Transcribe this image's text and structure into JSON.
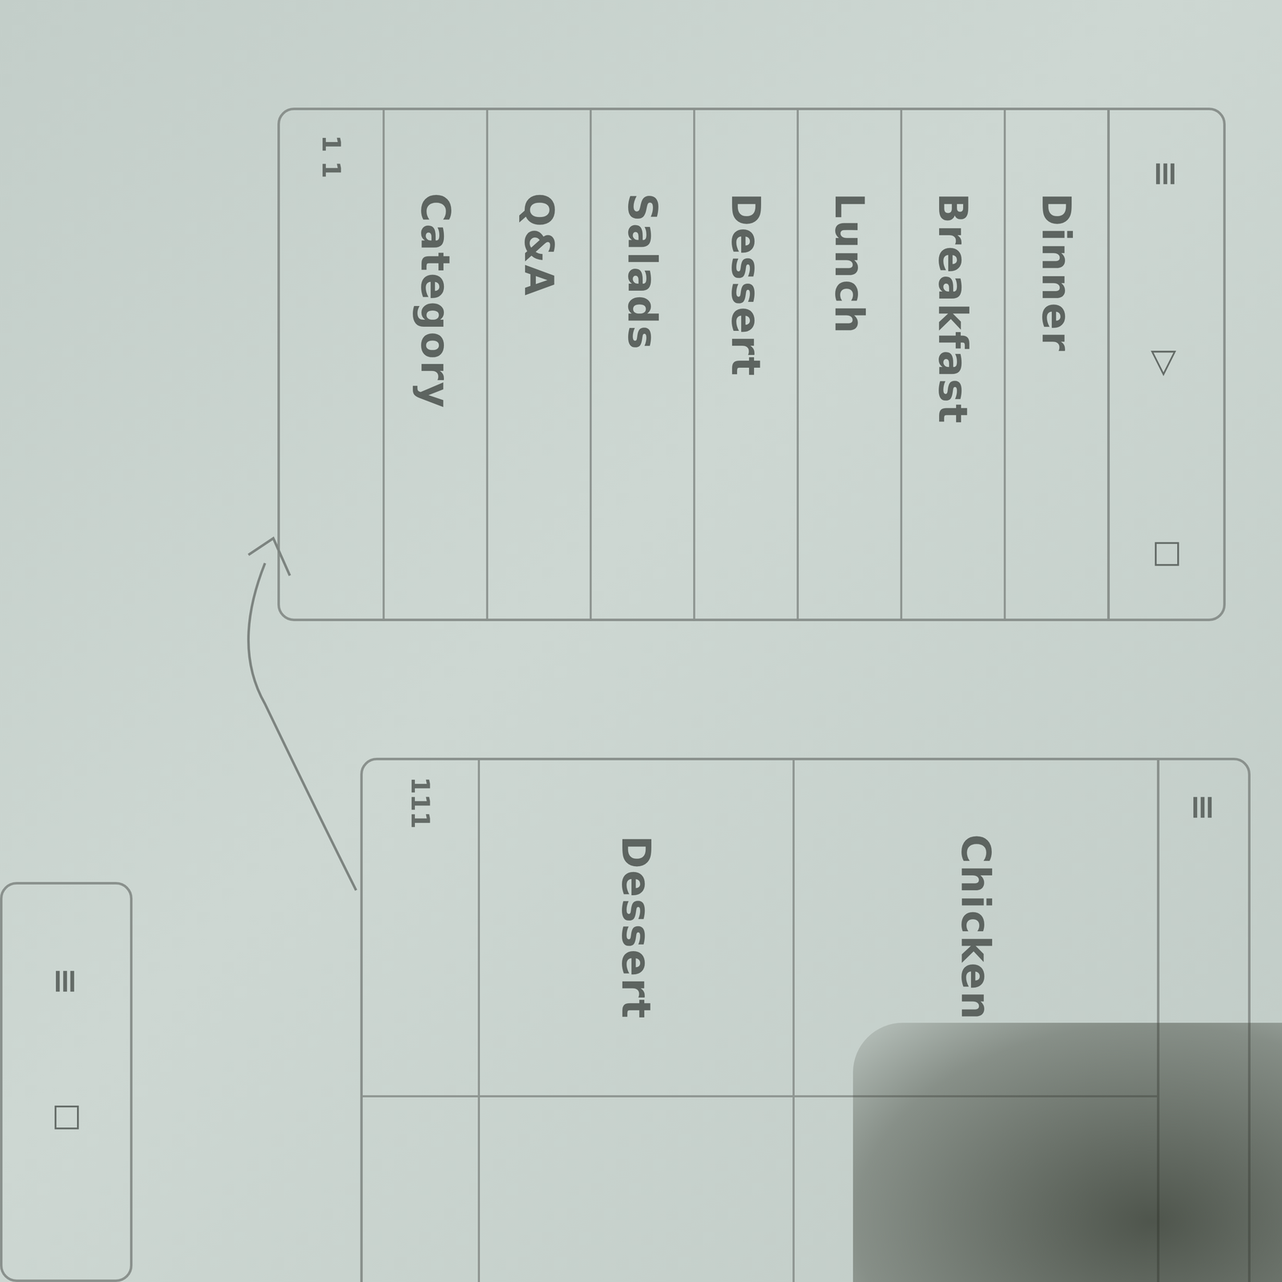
{
  "sketches": [
    {
      "name": "menu-screen",
      "header": [
        "≡",
        "▷",
        "☐"
      ],
      "items": [
        "Dinner",
        "Breakfast",
        "Lunch",
        "Dessert",
        "Salads",
        "Q&A",
        "Category"
      ],
      "footer": "1 1"
    },
    {
      "name": "detail-screen",
      "header": [
        "≡"
      ],
      "items": [
        "Chicken",
        "Dessert"
      ],
      "footer": "111"
    },
    {
      "name": "small-screen",
      "header": [
        "≡",
        "☐"
      ],
      "items": [],
      "footer": ""
    }
  ]
}
